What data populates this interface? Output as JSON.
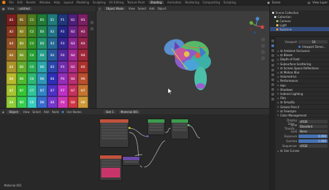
{
  "topbar": {
    "menus": [
      "File",
      "Edit",
      "Render",
      "Window",
      "Help"
    ],
    "workspaces": [
      "Layout",
      "Modeling",
      "Sculpting",
      "UV Editing",
      "Texture Paint",
      "Shading",
      "Animation",
      "Rendering",
      "Compositing",
      "Scripting"
    ],
    "active_workspace": "Shading",
    "scene": "Scene",
    "view_layer": "View Layer"
  },
  "image_editor": {
    "view_label": "View",
    "image_name": "untitled",
    "grid_labels": [
      [
        "A1",
        "B1",
        "C1",
        "D1",
        "E1",
        "F1",
        "G1",
        "H1"
      ],
      [
        "A2",
        "B2",
        "C2",
        "D2",
        "E2",
        "F2",
        "G2",
        "H2"
      ],
      [
        "A3",
        "B3",
        "C3",
        "D3",
        "E3",
        "F3",
        "G3",
        "H3"
      ],
      [
        "A4",
        "B4",
        "C4",
        "D4",
        "E4",
        "F4",
        "G4",
        "H4"
      ],
      [
        "A5",
        "B5",
        "C5",
        "D5",
        "E5",
        "F5",
        "G5",
        "H5"
      ],
      [
        "A6",
        "B6",
        "C6",
        "D6",
        "E6",
        "F6",
        "G6",
        "H6"
      ],
      [
        "A7",
        "B7",
        "C7",
        "D7",
        "E7",
        "F7",
        "G7",
        "H7"
      ],
      [
        "A8",
        "B8",
        "C8",
        "D8",
        "E8",
        "F8",
        "G8",
        "H8"
      ]
    ]
  },
  "viewport": {
    "mode": "Object Mode",
    "menus": [
      "View",
      "Select",
      "Add",
      "Object"
    ]
  },
  "node_editor": {
    "mode": "Object",
    "menus": [
      "View",
      "Select",
      "Add",
      "Node"
    ],
    "use_nodes": "Use Nodes",
    "slot": "Slot 1",
    "material": "Material.001",
    "footer_label": "Material.001"
  },
  "outliner": {
    "items": [
      {
        "label": "Scene Collection",
        "icon_color": "#cccccc",
        "selected": false
      },
      {
        "label": "Collection",
        "icon_color": "#cccccc",
        "selected": false
      },
      {
        "label": "Camera",
        "icon_color": "#8fbf5e",
        "selected": false
      },
      {
        "label": "Light",
        "icon_color": "#e0c060",
        "selected": false
      },
      {
        "label": "Suzanne",
        "icon_color": "#e58a3a",
        "selected": true
      }
    ]
  },
  "properties": {
    "viewport_label": "Viewport",
    "viewport_value": "16",
    "viewport_denoise": "Viewport Denoi...",
    "panels": [
      {
        "label": "Ambient Occlusion",
        "check": false
      },
      {
        "label": "Bloom",
        "check": false
      },
      {
        "label": "Depth of Field",
        "check": null
      },
      {
        "label": "Subsurface Scattering",
        "check": null
      },
      {
        "label": "Screen Space Reflections",
        "check": false
      },
      {
        "label": "Motion Blur",
        "check": false
      },
      {
        "label": "Volumetrics",
        "check": null
      },
      {
        "label": "Performance",
        "check": null
      },
      {
        "label": "Hair",
        "check": null
      },
      {
        "label": "Shadows",
        "check": null
      },
      {
        "label": "Indirect Lighting",
        "check": null
      },
      {
        "label": "Film",
        "check": null
      },
      {
        "label": "Simplify",
        "check": false
      },
      {
        "label": "Grease Pencil",
        "check": null
      },
      {
        "label": "Freestyle",
        "check": false
      },
      {
        "label": "Color Management",
        "check": null
      }
    ],
    "display_device": {
      "key": "Display Devi...",
      "value": "sRGB"
    },
    "view_transform": {
      "key": "View Transfo...",
      "value": "Standard"
    },
    "look": {
      "key": "Look",
      "value": "None"
    },
    "exposure": {
      "key": "Exposure",
      "value": "0.000"
    },
    "gamma": {
      "key": "Gamma",
      "value": "1.000"
    },
    "sequencer": {
      "key": "Sequencer",
      "value": "sRGB"
    },
    "use_curves": "Use Curves"
  }
}
